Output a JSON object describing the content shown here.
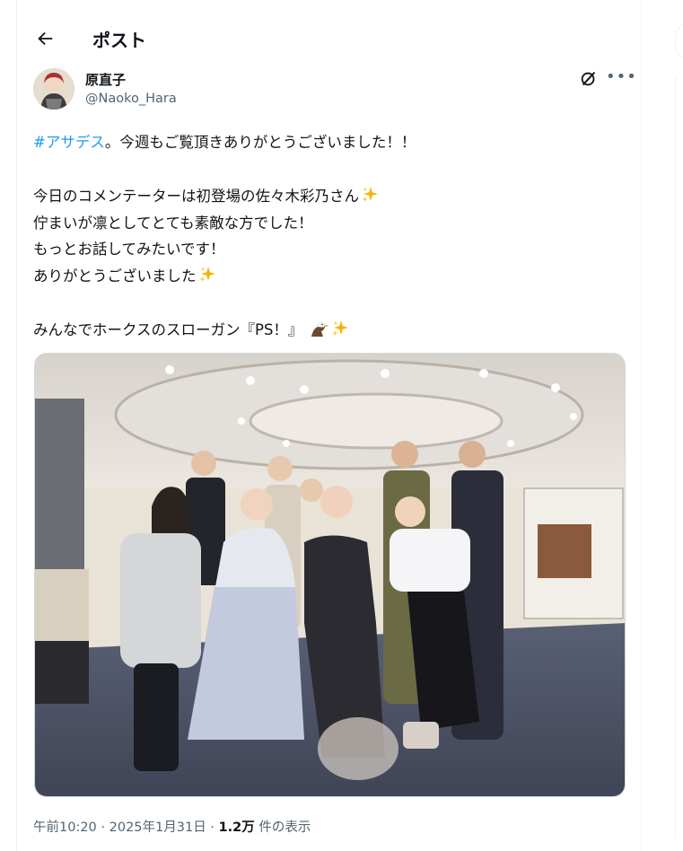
{
  "header": {
    "back_icon": "arrow-left-icon",
    "title": "ポスト"
  },
  "author": {
    "name": "原直子",
    "handle": "@Naoko_Hara",
    "avatar_icon": "avatar",
    "grok_icon": "grok-icon",
    "more_icon": "more-icon"
  },
  "post": {
    "hashtag": "#アサデス",
    "line1_rest": "。今週もご覧頂きありがとうございました！！",
    "line2": "今日のコメンテーターは初登場の佐々木彩乃さん",
    "line3": "佇まいが凛としてとても素敵な方でした！",
    "line4": "もっとお話してみたいです！",
    "line5": "ありがとうございました",
    "line6": "みんなでホークスのスローガン『PS！』",
    "emoji_sparkles": "sparkles-icon",
    "emoji_eagle": "eagle-icon"
  },
  "meta": {
    "time": "午前10:20",
    "separator": " · ",
    "date": "2025年1月31日",
    "views_count": "1.2万",
    "views_label": " 件の表示"
  },
  "colors": {
    "link": "#1d9bf0",
    "secondary": "#536471",
    "primary_text": "#0f1419"
  }
}
